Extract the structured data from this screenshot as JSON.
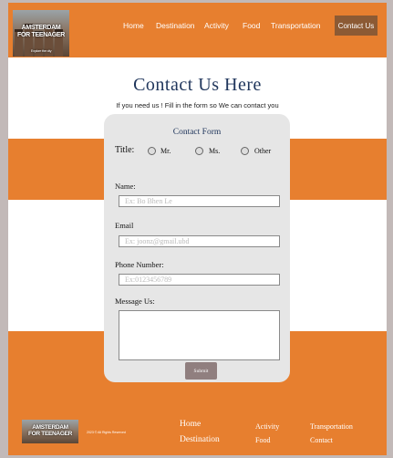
{
  "header": {
    "logo": {
      "line1": "AMSTERDAM",
      "line2": "FOR TEENAGER",
      "sub": "Explore the city"
    },
    "nav": [
      "Home",
      "Destination",
      "Activity",
      "Food",
      "Transportation"
    ],
    "contact_button": "Contact Us"
  },
  "hero": {
    "title": "Contact Us Here",
    "subtitle": "If you need us ! Fill in the form so We can contact you"
  },
  "form": {
    "title": "Contact Form",
    "title_label": "Title:",
    "title_options": [
      "Mr.",
      "Ms.",
      "Other"
    ],
    "name_label": "Name:",
    "name_placeholder": "Ex: Bo Bhen Le",
    "email_label": "Email",
    "email_placeholder": "Ex: joonz@gmail.ubd",
    "phone_label": "Phone Number:",
    "phone_placeholder": "Ex:0123456789",
    "message_label": "Message Us:",
    "message_value": "",
    "submit_label": "Submit"
  },
  "footer": {
    "logo": {
      "line1": "AMSTERDAM",
      "line2": "FOR TEENAGER"
    },
    "copyright": "2023 © All Rights Reserved",
    "links": {
      "home": "Home",
      "destination": "Destination",
      "activity": "Activity",
      "food": "Food",
      "transportation": "Transportation",
      "contact": "Contact"
    }
  },
  "colors": {
    "orange": "#e77f2f",
    "contact_button": "#8c5a34",
    "navy": "#20365c",
    "submit": "#907f7f",
    "card": "#e6e6e6"
  }
}
